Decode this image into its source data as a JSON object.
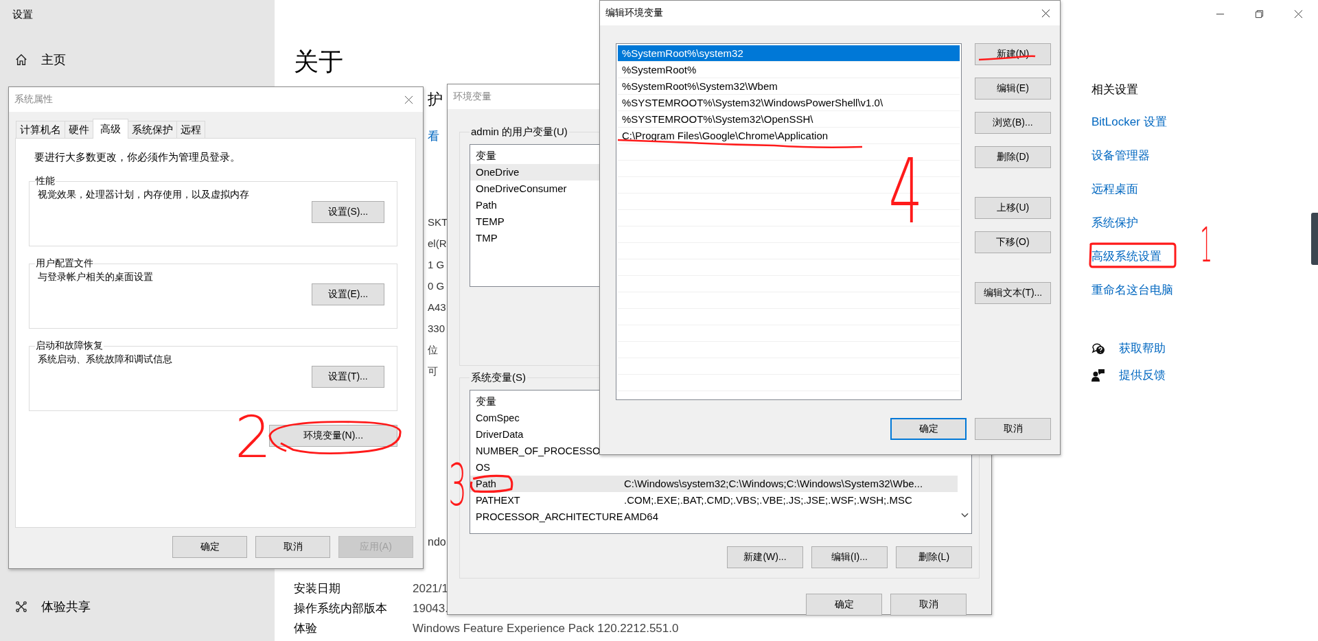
{
  "settings": {
    "title": "设置",
    "nav": [
      {
        "kind": "home",
        "label": "主页"
      },
      {
        "kind": "share",
        "label": "体验共享"
      }
    ],
    "heading": "关于",
    "subtitle_fragment": "护",
    "link_fragment": "看",
    "spec_fragments": [
      "SKT",
      "el(R",
      "1 G",
      "0 G",
      "A43",
      "330",
      "位",
      "可"
    ],
    "version_fragment": "ndo",
    "info_rows": [
      {
        "label": "安装日期",
        "value": "2021/1"
      },
      {
        "label": "操作系统内部版本",
        "value": "19043."
      },
      {
        "label": "体验",
        "value": "Windows Feature Experience Pack 120.2212.551.0"
      }
    ],
    "related": {
      "title": "相关设置",
      "step": "1",
      "links": [
        {
          "label": "BitLocker 设置",
          "boxed": false
        },
        {
          "label": "设备管理器",
          "boxed": false
        },
        {
          "label": "远程桌面",
          "boxed": false
        },
        {
          "label": "系统保护",
          "boxed": false
        },
        {
          "label": "高级系统设置",
          "boxed": true
        },
        {
          "label": "重命名这台电脑",
          "boxed": false
        }
      ]
    },
    "help": [
      {
        "kind": "help",
        "label": "获取帮助"
      },
      {
        "kind": "feedback",
        "label": "提供反馈"
      }
    ]
  },
  "system_properties": {
    "title": "系统属性",
    "step": "2",
    "tabs": [
      {
        "label": "计算机名",
        "selected": false
      },
      {
        "label": "硬件",
        "selected": false
      },
      {
        "label": "高级",
        "selected": true
      },
      {
        "label": "系统保护",
        "selected": false
      },
      {
        "label": "远程",
        "selected": false
      }
    ],
    "notice": "要进行大多数更改，你必须作为管理员登录。",
    "groups": [
      {
        "title": "性能",
        "description": "视觉效果，处理器计划，内存使用，以及虚拟内存",
        "button": "设置(S)..."
      },
      {
        "title": "用户配置文件",
        "description": "与登录帐户相关的桌面设置",
        "button": "设置(E)..."
      },
      {
        "title": "启动和故障恢复",
        "description": "系统启动、系统故障和调试信息",
        "button": "设置(T)..."
      }
    ],
    "env_button": {
      "label": "环境变量(N)...",
      "circled": true
    },
    "buttons": [
      {
        "label": "确定",
        "disabled": false
      },
      {
        "label": "取消",
        "disabled": false
      },
      {
        "label": "应用(A)",
        "disabled": true
      }
    ]
  },
  "environment_variables": {
    "title": "环境变量",
    "step": "3",
    "user_group": {
      "label": "admin 的用户变量(U)",
      "header": "变量",
      "rows": [
        {
          "name": "OneDrive",
          "selected": true
        },
        {
          "name": "OneDriveConsumer",
          "selected": false
        },
        {
          "name": "Path",
          "selected": false
        },
        {
          "name": "TEMP",
          "selected": false
        },
        {
          "name": "TMP",
          "selected": false
        }
      ]
    },
    "system_group": {
      "label": "系统变量(S)",
      "header": "变量",
      "rows": [
        {
          "name": "ComSpec",
          "selected": false,
          "circled": false
        },
        {
          "name": "DriverData",
          "selected": false,
          "circled": false
        },
        {
          "name": "NUMBER_OF_PROCESSO",
          "selected": false,
          "circled": false
        },
        {
          "name": "OS",
          "selected": false,
          "circled": false
        },
        {
          "name": "Path",
          "value": "C:\\Windows\\system32;C:\\Windows;C:\\Windows\\System32\\Wbe...",
          "selected": true,
          "circled": true
        },
        {
          "name": "PATHEXT",
          "value": ".COM;.EXE;.BAT;.CMD;.VBS;.VBE;.JS;.JSE;.WSF;.WSH;.MSC",
          "selected": false,
          "circled": false
        },
        {
          "name": "PROCESSOR_ARCHITECTURE",
          "value": "AMD64",
          "selected": false,
          "circled": false
        }
      ]
    },
    "group_buttons": [
      "新建(W)...",
      "编辑(I)...",
      "删除(L)"
    ],
    "buttons": [
      "确定",
      "取消"
    ]
  },
  "edit_dialog": {
    "title": "编辑环境变量",
    "step": "4",
    "entries": [
      {
        "text": "%SystemRoot%\\system32",
        "selected": true,
        "underlined": false
      },
      {
        "text": "%SystemRoot%",
        "selected": false,
        "underlined": false
      },
      {
        "text": "%SystemRoot%\\System32\\Wbem",
        "selected": false,
        "underlined": false
      },
      {
        "text": "%SYSTEMROOT%\\System32\\WindowsPowerShell\\v1.0\\",
        "selected": false,
        "underlined": false
      },
      {
        "text": "%SYSTEMROOT%\\System32\\OpenSSH\\",
        "selected": false,
        "underlined": false
      },
      {
        "text": "C:\\Program Files\\Google\\Chrome\\Application",
        "selected": false,
        "underlined": true
      }
    ],
    "button_groups": [
      [
        {
          "label": "新建(N)",
          "underlined": true
        },
        {
          "label": "编辑(E)",
          "underlined": false
        },
        {
          "label": "浏览(B)...",
          "underlined": false
        },
        {
          "label": "删除(D)",
          "underlined": false
        }
      ],
      [
        {
          "label": "上移(U)",
          "underlined": false
        },
        {
          "label": "下移(O)",
          "underlined": false
        }
      ],
      [
        {
          "label": "编辑文本(T)...",
          "underlined": false
        }
      ]
    ],
    "buttons": [
      {
        "label": "确定",
        "default": true
      },
      {
        "label": "取消",
        "default": false
      }
    ]
  }
}
